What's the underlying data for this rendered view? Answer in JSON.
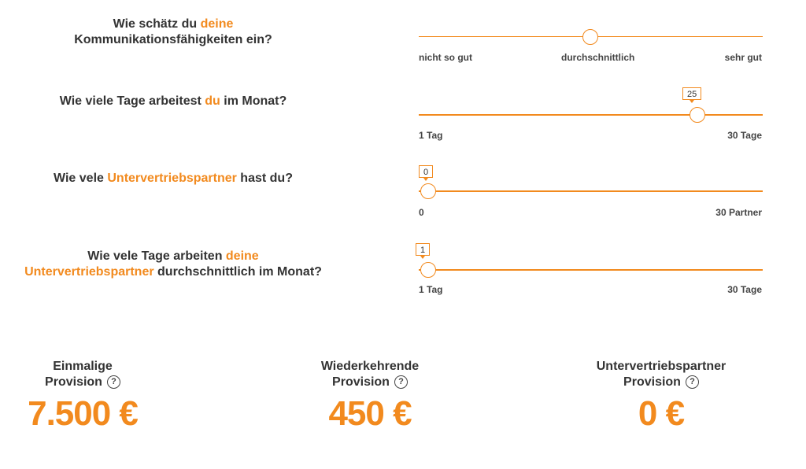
{
  "q1": {
    "pre": "Wie schätz du ",
    "accent": "deine",
    "post": "Kommunikationsfähigkeiten ein?",
    "slider": {
      "value_label": "durchschnittlich",
      "position": 0.5
    },
    "labels": {
      "left": "nicht so gut",
      "mid": "durchschnittlich",
      "right": "sehr gut"
    }
  },
  "q2": {
    "pre": "Wie viele Tage arbeitest ",
    "accent": "du",
    "post": " im Monat?",
    "slider": {
      "value": "25",
      "min": 1,
      "max": 30
    },
    "labels": {
      "left": "1 Tag",
      "right": "30 Tage"
    }
  },
  "q3": {
    "pre": "Wie vele ",
    "accent": "Untervertriebspartner",
    "post": " hast du?",
    "slider": {
      "value": "0",
      "min": 0,
      "max": 30
    },
    "labels": {
      "left": "0",
      "right": "30 Partner"
    }
  },
  "q4": {
    "pre": "Wie vele Tage arbeiten ",
    "accent": "deine",
    "accent2": "Untervertriebspartner",
    "post": " durchschnittlich im Monat?",
    "slider": {
      "value": "1",
      "min": 1,
      "max": 30
    },
    "labels": {
      "left": "1 Tag",
      "right": "30 Tage"
    }
  },
  "results": [
    {
      "line1": "Einmalige",
      "line2": "Provision",
      "amount": "7.500 €",
      "help": "?"
    },
    {
      "line1": "Wiederkehrende",
      "line2": "Provision",
      "amount": "450 €",
      "help": "?"
    },
    {
      "line1": "Untervertriebspartner",
      "line2": "Provision",
      "amount": "0 €",
      "help": "?"
    }
  ],
  "colors": {
    "accent": "#f28a1e",
    "text": "#333333"
  }
}
